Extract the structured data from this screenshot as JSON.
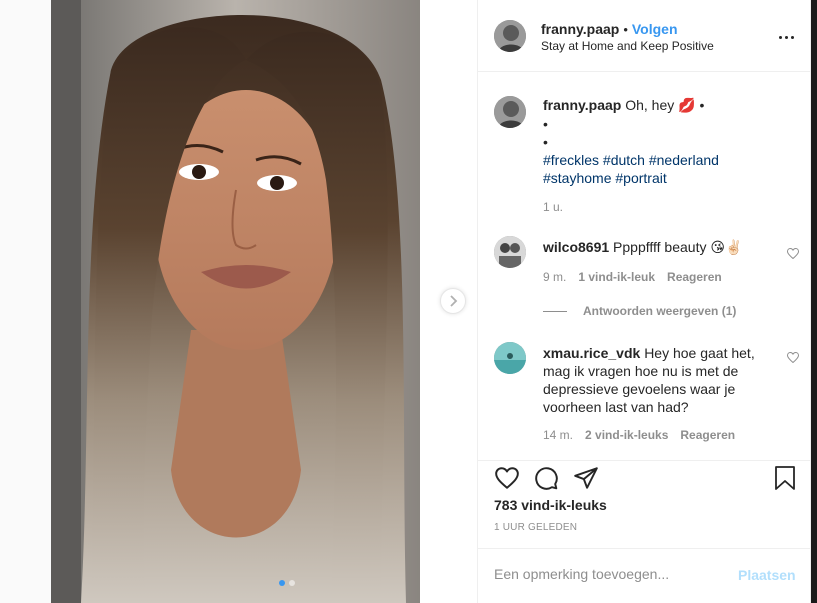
{
  "post": {
    "username": "franny.paap",
    "follow_label": "Volgen",
    "separator": "•",
    "location": "Stay at Home and Keep Positive"
  },
  "caption": {
    "username": "franny.paap",
    "text": "Oh, hey",
    "emoji": "💋",
    "bullet": "•",
    "hashtags_line1": [
      "#freckles",
      "#dutch",
      "#nederland"
    ],
    "hashtags_line2": [
      "#stayhome",
      "#portrait"
    ],
    "time": "1 u."
  },
  "comments": [
    {
      "username": "wilco8691",
      "text": "Ppppffff beauty",
      "emoji": "😘✌🏻",
      "time": "9 m.",
      "likes": "1 vind-ik-leuk",
      "reply": "Reageren",
      "view_replies": "Antwoorden weergeven (1)"
    },
    {
      "username": "xmau.rice_vdk",
      "text_lines": [
        "Hey hoe gaat het,",
        "mag ik vragen hoe nu is met de",
        "depressieve gevoelens waar je",
        "voorheen last van had?"
      ],
      "time": "14 m.",
      "likes": "2 vind-ik-leuks",
      "reply": "Reageren"
    }
  ],
  "stats": {
    "likes": "783 vind-ik-leuks",
    "posted": "1 UUR GELEDEN"
  },
  "add_comment": {
    "placeholder": "Een opmerking toevoegen...",
    "post_label": "Plaatsen"
  },
  "carousel": {
    "count": 2,
    "active": 1
  },
  "colors": {
    "accent": "#3897f0",
    "hashtag": "#003569",
    "muted": "#8e8e8e",
    "post_disabled": "#b2dffc"
  },
  "icons": [
    "heart-icon",
    "comment-icon",
    "share-icon",
    "bookmark-icon",
    "more-options-icon",
    "chevron-right-icon"
  ]
}
